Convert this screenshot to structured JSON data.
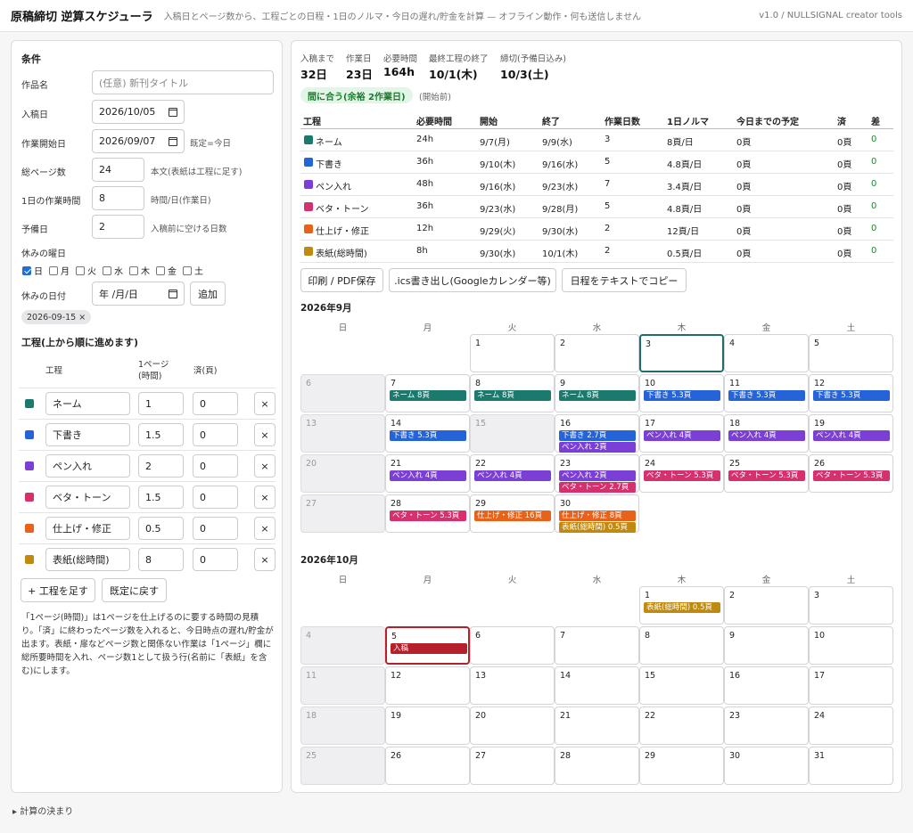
{
  "header": {
    "title": "原稿締切 逆算スケジューラ",
    "subtitle": "入稿日とページ数から、工程ごとの日程・1日のノルマ・今日の遅れ/貯金を計算 — オフライン動作・何も送信しません",
    "version": "v1.0 / NULLSIGNAL creator tools"
  },
  "conditions": {
    "title": "条件",
    "work_name": {
      "label": "作品名",
      "placeholder": "(任意) 新刊タイトル"
    },
    "due_date": {
      "label": "入稿日",
      "value": "2026/10/05"
    },
    "start_date": {
      "label": "作業開始日",
      "value": "2026/09/07",
      "hint": "既定=今日"
    },
    "pages": {
      "label": "総ページ数",
      "value": "24",
      "hint": "本文(表紙は工程に足す)"
    },
    "hours": {
      "label": "1日の作業時間",
      "value": "8",
      "hint": "時間/日(作業日)"
    },
    "buffer": {
      "label": "予備日",
      "value": "2",
      "hint": "入稿前に空ける日数"
    },
    "holidays_label": "休みの曜日",
    "weekdays": [
      {
        "label": "日",
        "checked": true
      },
      {
        "label": "月",
        "checked": false
      },
      {
        "label": "火",
        "checked": false
      },
      {
        "label": "水",
        "checked": false
      },
      {
        "label": "木",
        "checked": false
      },
      {
        "label": "金",
        "checked": false
      },
      {
        "label": "土",
        "checked": false
      }
    ],
    "offdate": {
      "label": "休みの日付",
      "value": "年 /月/日",
      "add": "追加"
    },
    "offdate_chips": [
      "2026-09-15 ×"
    ]
  },
  "process_editor": {
    "title": "工程(上から順に進めます)",
    "headers": {
      "name": "工程",
      "per_page": "1ページ\n(時間)",
      "done": "済(頁)"
    },
    "rows": [
      {
        "name": "ネーム",
        "per_page": "1",
        "done": "0",
        "color": "#1b7a6e"
      },
      {
        "name": "下書き",
        "per_page": "1.5",
        "done": "0",
        "color": "#2563d8"
      },
      {
        "name": "ペン入れ",
        "per_page": "2",
        "done": "0",
        "color": "#7b3fd6"
      },
      {
        "name": "ベタ・トーン",
        "per_page": "1.5",
        "done": "0",
        "color": "#d6306e"
      },
      {
        "name": "仕上げ・修正",
        "per_page": "0.5",
        "done": "0",
        "color": "#e8621a"
      },
      {
        "name": "表紙(総時間)",
        "per_page": "8",
        "done": "0",
        "color": "#c08a10"
      }
    ],
    "remove_label": "×",
    "add_label": "+ 工程を足す",
    "reset_label": "既定に戻す",
    "note": "「1ページ(時間)」は1ページを仕上げるのに要する時間の見積り。「済」に終わったページ数を入れると、今日時点の遅れ/貯金が出ます。表紙・扉などページ数と関係ない作業は「1ページ」欄に総所要時間を入れ、ページ数1として扱う行(名前に「表紙」を含む)にします。"
  },
  "summary": {
    "stats": [
      {
        "label": "入稿まで",
        "value": "32日"
      },
      {
        "label": "作業日",
        "value": "23日"
      },
      {
        "label": "必要時間",
        "value": "164h"
      },
      {
        "label": "最終工程の終了",
        "value": "10/1(木)"
      },
      {
        "label": "締切(予備日込み)",
        "value": "10/3(土)"
      }
    ],
    "status": "間に合う(余裕 2作業日)",
    "status_note": "(開始前)"
  },
  "schedule_table": {
    "headers": [
      "工程",
      "必要時間",
      "開始",
      "終了",
      "作業日数",
      "1日ノルマ",
      "今日までの予定",
      "済",
      "差"
    ],
    "rows": [
      {
        "name": "ネーム",
        "hours": "24h",
        "start": "9/7(月)",
        "end": "9/9(水)",
        "days": "3",
        "quota": "8頁/日",
        "planned": "0頁",
        "done": "0頁",
        "diff": "0",
        "color": "#1b7a6e"
      },
      {
        "name": "下書き",
        "hours": "36h",
        "start": "9/10(木)",
        "end": "9/16(水)",
        "days": "5",
        "quota": "4.8頁/日",
        "planned": "0頁",
        "done": "0頁",
        "diff": "0",
        "color": "#2563d8"
      },
      {
        "name": "ペン入れ",
        "hours": "48h",
        "start": "9/16(水)",
        "end": "9/23(水)",
        "days": "7",
        "quota": "3.4頁/日",
        "planned": "0頁",
        "done": "0頁",
        "diff": "0",
        "color": "#7b3fd6"
      },
      {
        "name": "ベタ・トーン",
        "hours": "36h",
        "start": "9/23(水)",
        "end": "9/28(月)",
        "days": "5",
        "quota": "4.8頁/日",
        "planned": "0頁",
        "done": "0頁",
        "diff": "0",
        "color": "#d6306e"
      },
      {
        "name": "仕上げ・修正",
        "hours": "12h",
        "start": "9/29(火)",
        "end": "9/30(水)",
        "days": "2",
        "quota": "12頁/日",
        "planned": "0頁",
        "done": "0頁",
        "diff": "0",
        "color": "#e8621a"
      },
      {
        "name": "表紙(総時間)",
        "hours": "8h",
        "start": "9/30(水)",
        "end": "10/1(木)",
        "days": "2",
        "quota": "0.5頁/日",
        "planned": "0頁",
        "done": "0頁",
        "diff": "0",
        "color": "#c08a10"
      }
    ]
  },
  "actions": {
    "print": "印刷 / PDF保存",
    "ics": ".ics書き出し(Googleカレンダー等)",
    "copy": "日程をテキストでコピー"
  },
  "weekday_headers": [
    "日",
    "月",
    "火",
    "水",
    "木",
    "金",
    "土"
  ],
  "calendar": {
    "months": [
      {
        "title": "2026年9月",
        "first_weekday": 2,
        "days": 30,
        "off": [
          6,
          13,
          15,
          20,
          27
        ],
        "today": 3,
        "due": null,
        "events": {
          "7": [
            [
              "ネーム 8頁",
              0
            ]
          ],
          "8": [
            [
              "ネーム 8頁",
              0
            ]
          ],
          "9": [
            [
              "ネーム 8頁",
              0
            ]
          ],
          "10": [
            [
              "下書き 5.3頁",
              1
            ]
          ],
          "11": [
            [
              "下書き 5.3頁",
              1
            ]
          ],
          "12": [
            [
              "下書き 5.3頁",
              1
            ]
          ],
          "14": [
            [
              "下書き 5.3頁",
              1
            ]
          ],
          "16": [
            [
              "下書き 2.7頁",
              1
            ],
            [
              "ペン入れ 2頁",
              2
            ]
          ],
          "17": [
            [
              "ペン入れ 4頁",
              2
            ]
          ],
          "18": [
            [
              "ペン入れ 4頁",
              2
            ]
          ],
          "19": [
            [
              "ペン入れ 4頁",
              2
            ]
          ],
          "21": [
            [
              "ペン入れ 4頁",
              2
            ]
          ],
          "22": [
            [
              "ペン入れ 4頁",
              2
            ]
          ],
          "23": [
            [
              "ペン入れ 2頁",
              2
            ],
            [
              "ベタ・トーン 2.7頁",
              3
            ]
          ],
          "24": [
            [
              "ベタ・トーン 5.3頁",
              3
            ]
          ],
          "25": [
            [
              "ベタ・トーン 5.3頁",
              3
            ]
          ],
          "26": [
            [
              "ベタ・トーン 5.3頁",
              3
            ]
          ],
          "28": [
            [
              "ベタ・トーン 5.3頁",
              3
            ]
          ],
          "29": [
            [
              "仕上げ・修正 16頁",
              4
            ]
          ],
          "30": [
            [
              "仕上げ・修正 8頁",
              4
            ],
            [
              "表紙(総時間) 0.5頁",
              5
            ]
          ]
        }
      },
      {
        "title": "2026年10月",
        "first_weekday": 4,
        "days": 31,
        "off": [
          4,
          11,
          18,
          25
        ],
        "today": null,
        "due": 5,
        "events": {
          "1": [
            [
              "表紙(総時間) 0.5頁",
              5
            ]
          ],
          "5": [
            [
              "入稿",
              6
            ]
          ]
        }
      }
    ],
    "event_colors": [
      "#1b7a6e",
      "#2563d8",
      "#7b3fd6",
      "#d6306e",
      "#e8621a",
      "#c08a10",
      "#b5202a"
    ]
  },
  "footer": {
    "details": "▸ 計算の決まり"
  }
}
